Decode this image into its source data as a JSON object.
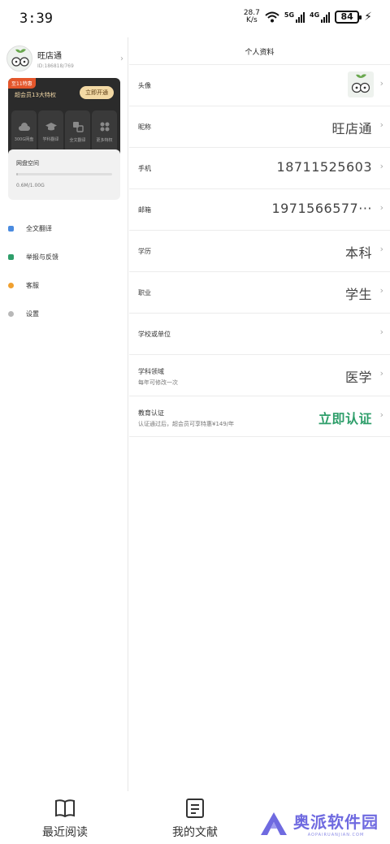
{
  "status": {
    "time": "3:39",
    "net_speed_value": "28.7",
    "net_speed_unit": "K/s",
    "net1": "5G",
    "net2": "4G",
    "battery": "84"
  },
  "drawer": {
    "name": "旺店通",
    "id": "ID:186818/769",
    "vip_tag": "至11特惠",
    "vip_desc": "超会员13大特权",
    "vip_open": "立即开通",
    "vip_items": [
      "300G网盘",
      "学科翻译",
      "全文翻译",
      "更多特权"
    ],
    "storage_title": "网盘空间",
    "storage_value": "0.6M/1.00G",
    "storage_fill": 0.01,
    "menu": [
      {
        "label": "全文翻译",
        "color": "#4a8be0"
      },
      {
        "label": "举报与反馈",
        "color": "#2e9e6a"
      },
      {
        "label": "客服",
        "color": "#f0a030"
      },
      {
        "label": "设置",
        "color": "#b8b8b8"
      }
    ]
  },
  "panel": {
    "title": "个人资料",
    "rows": {
      "avatar": "头像",
      "nickname": {
        "label": "昵称",
        "value": "旺店通"
      },
      "phone": {
        "label": "手机",
        "value": "18711525603"
      },
      "email": {
        "label": "邮箱",
        "value": "1971566577···"
      },
      "education": {
        "label": "学历",
        "value": "本科"
      },
      "job": {
        "label": "职业",
        "value": "学生"
      },
      "school": {
        "label": "学校或单位"
      },
      "field": {
        "label": "学科领域",
        "note": "每年可修改一次",
        "value": "医学"
      },
      "edu_cert": {
        "label": "教育认证",
        "note": "认证通过后，超会员可享特惠¥149/年",
        "value": "立即认证"
      }
    },
    "arrow": "›"
  },
  "nav": {
    "recent": "最近阅读",
    "mine": "我的文献"
  },
  "watermark": {
    "text": "奥派软件园",
    "sub": "AOPAIRUANJIAN.COM"
  }
}
